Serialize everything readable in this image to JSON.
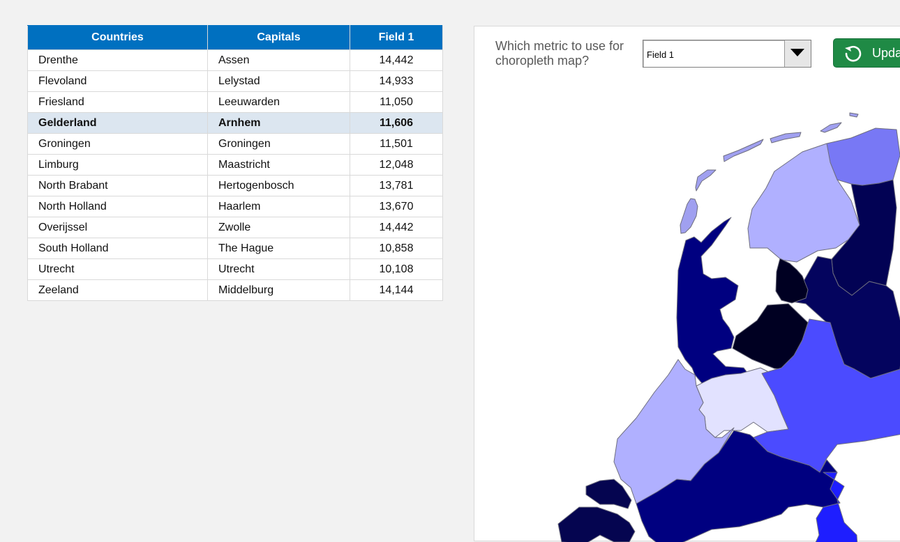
{
  "table": {
    "headers": {
      "country": "Countries",
      "capital": "Capitals",
      "field": "Field 1"
    },
    "selected_index": 3,
    "rows": [
      {
        "country": "Drenthe",
        "capital": "Assen",
        "value": "14,442"
      },
      {
        "country": "Flevoland",
        "capital": "Lelystad",
        "value": "14,933"
      },
      {
        "country": "Friesland",
        "capital": "Leeuwarden",
        "value": "11,050"
      },
      {
        "country": "Gelderland",
        "capital": "Arnhem",
        "value": "11,606"
      },
      {
        "country": "Groningen",
        "capital": "Groningen",
        "value": "11,501"
      },
      {
        "country": "Limburg",
        "capital": "Maastricht",
        "value": "12,048"
      },
      {
        "country": "North Brabant",
        "capital": "Hertogenbosch",
        "value": "13,781"
      },
      {
        "country": "North Holland",
        "capital": "Haarlem",
        "value": "13,670"
      },
      {
        "country": "Overijssel",
        "capital": "Zwolle",
        "value": "14,442"
      },
      {
        "country": "South Holland",
        "capital": "The Hague",
        "value": "10,858"
      },
      {
        "country": "Utrecht",
        "capital": "Utrecht",
        "value": "10,108"
      },
      {
        "country": "Zeeland",
        "capital": "Middelburg",
        "value": "14,144"
      }
    ]
  },
  "controls": {
    "metric_question": "Which metric to use for choropleth map?",
    "metric_selected": "Field 1",
    "update_label": "Update",
    "update_icon": "refresh-icon",
    "dropdown_icon": "caret-down-icon"
  },
  "colors": {
    "header_bg": "#0070c0",
    "selected_row_bg": "#dce6f0",
    "update_button_bg": "#1f8a45",
    "map": {
      "Friesland": "#b0b0ff",
      "Groningen": "#7878f5",
      "Drenthe": "#020254",
      "Overijssel": "#04045e",
      "Flevoland": "#000022",
      "North Holland": "#000080",
      "South Holland": "#b0b0ff",
      "Utrecht": "#e2e2ff",
      "Gelderland": "#4b4bff",
      "North Brabant": "#000080",
      "Limburg": "#1e1eff",
      "Zeeland": "#050550",
      "Waddeneilanden": "#a0a0f0"
    }
  }
}
